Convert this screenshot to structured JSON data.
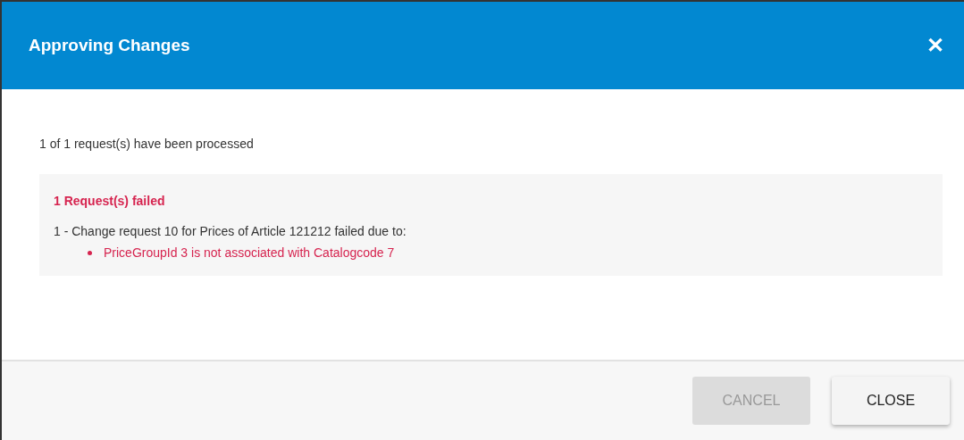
{
  "dialog": {
    "title": "Approving Changes",
    "close_symbol": "✕"
  },
  "summary": "1 of 1 request(s) have been processed",
  "failures": {
    "heading": "1 Request(s) failed",
    "items": [
      {
        "text": "1 - Change request 10 for Prices of Article 121212 failed due to:",
        "reasons": [
          "PriceGroupId 3 is not associated with Catalogcode 7"
        ]
      }
    ]
  },
  "buttons": [
    {
      "label": "CANCEL",
      "disabled": true
    },
    {
      "label": "CLOSE",
      "disabled": false
    }
  ]
}
